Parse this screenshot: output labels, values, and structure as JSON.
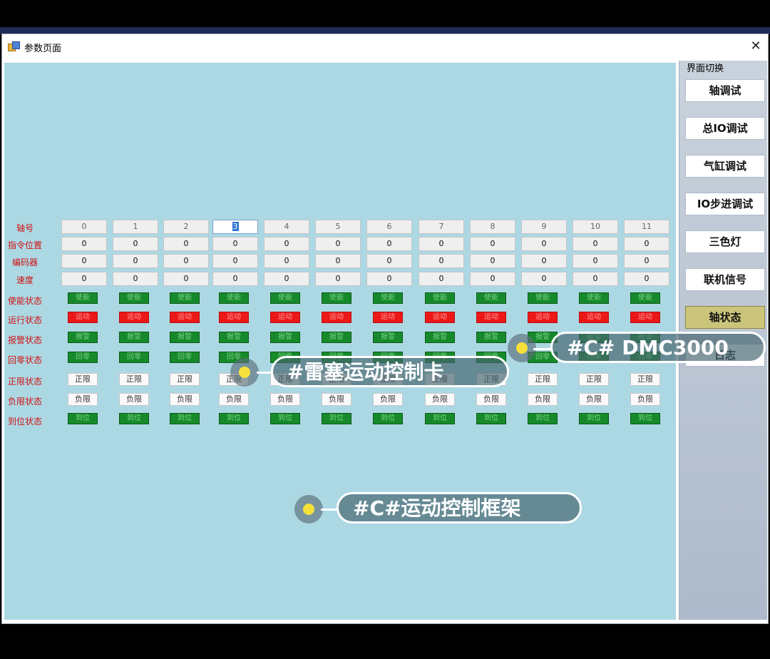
{
  "window": {
    "title": "参数页面",
    "close_glyph": "✕"
  },
  "sidebar": {
    "title": "界面切换",
    "buttons": [
      {
        "label": "轴调试",
        "active": false
      },
      {
        "label": "总IO调试",
        "active": false
      },
      {
        "label": "气缸调试",
        "active": false
      },
      {
        "label": "IO步进调试",
        "active": false
      },
      {
        "label": "三色灯",
        "active": false
      },
      {
        "label": "联机信号",
        "active": false
      },
      {
        "label": "轴状态",
        "active": true
      },
      {
        "label": "日志",
        "active": false
      }
    ]
  },
  "table": {
    "row_labels": [
      "轴号",
      "指令位置",
      "编码器",
      "速度",
      "使能状态",
      "运行状态",
      "报警状态",
      "回零状态",
      "正限状态",
      "负限状态",
      "到位状态"
    ],
    "axis_numbers": [
      "0",
      "1",
      "2",
      "3",
      "4",
      "5",
      "6",
      "7",
      "8",
      "9",
      "10",
      "11"
    ],
    "selected_axis": "3",
    "command_position": [
      "0",
      "0",
      "0",
      "0",
      "0",
      "0",
      "0",
      "0",
      "0",
      "0",
      "0",
      "0"
    ],
    "encoder": [
      "0",
      "0",
      "0",
      "0",
      "0",
      "0",
      "0",
      "0",
      "0",
      "0",
      "0",
      "0"
    ],
    "speed": [
      "0",
      "0",
      "0",
      "0",
      "0",
      "0",
      "0",
      "0",
      "0",
      "0",
      "0",
      "0"
    ],
    "enable_text": "使能",
    "run_text": "运动",
    "alarm_text": "报警",
    "home_text": "回零",
    "pos_limit_text": "正限",
    "neg_limit_text": "负限",
    "in_position_text": "到位",
    "colors": {
      "on_green": "#168a2a",
      "on_red": "#ec1818",
      "off_white": "#fafafa",
      "label_red": "#d01010"
    }
  },
  "overlay_tags": [
    "#C# DMC3000",
    "#雷塞运动控制卡",
    "#C#运动控制框架"
  ]
}
